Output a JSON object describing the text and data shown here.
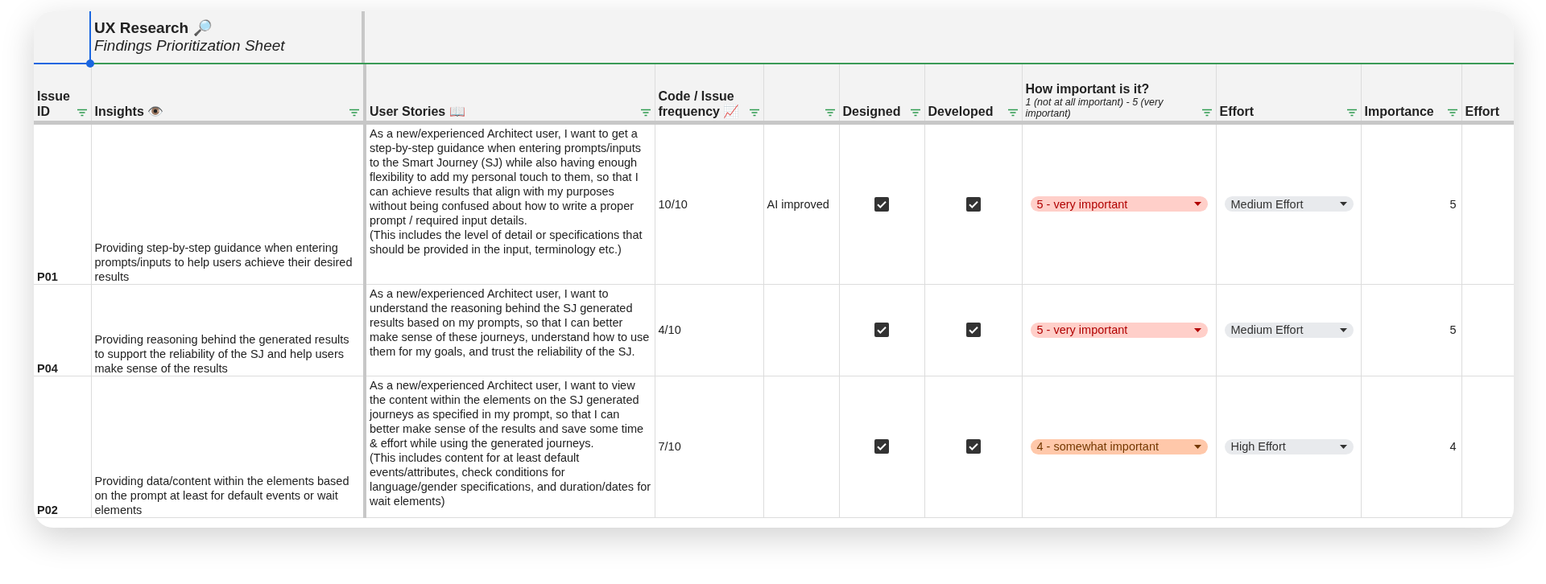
{
  "title": "UX Research 🔎",
  "subtitle": "Findings Prioritization Sheet",
  "columns": [
    {
      "label": "Issue ID",
      "filter": true
    },
    {
      "label": "Insights 👁️",
      "filter": true
    },
    {
      "label": "User Stories 📖",
      "filter": true
    },
    {
      "label": "Code / Issue frequency 📈",
      "filter": true
    },
    {
      "filter": true
    },
    {
      "label": "Designed",
      "filter": true
    },
    {
      "label": "Developed",
      "filter": true
    },
    {
      "label": "How important is it?",
      "note": "1 (not at all important) - 5 (very important)",
      "filter": true
    },
    {
      "label": "Effort",
      "filter": true
    },
    {
      "label": "Importance",
      "filter": true
    },
    {
      "label": "Effort",
      "filter": false
    }
  ],
  "rows": [
    {
      "issue_id": "P01",
      "insight": "Providing step-by-step guidance when entering prompts/inputs to help users achieve their desired results",
      "user_story": "As a new/experienced Architect user, I want to get a step-by-step guidance when entering prompts/inputs to the Smart Journey (SJ) while also having enough flexibility to add my personal touch to them, so that I can achieve results that align with my purposes without being confused about how to write a proper prompt / required input details.\n(This includes the level of detail or specifications that should be provided in the input, terminology etc.)",
      "frequency": "10/10",
      "column_5": "AI improved",
      "designed": true,
      "developed": true,
      "how_important": {
        "text": "5 - very important",
        "color": "#ffcfc9"
      },
      "effort": "Medium Effort",
      "importance": "5"
    },
    {
      "issue_id": "P04",
      "insight": "Providing reasoning behind the generated results to support the reliability of the SJ and help users make sense of the results",
      "user_story": "As a new/experienced Architect user, I want to understand the reasoning behind the SJ generated results based on my prompts, so that I can better make sense of these journeys, understand how to use them for my goals, and trust the reliability of the SJ.",
      "frequency": "4/10",
      "designed": true,
      "developed": true,
      "how_important": {
        "text": "5 - very important",
        "color": "#ffcfc9"
      },
      "effort": "Medium Effort",
      "importance": "5"
    },
    {
      "issue_id": "P02",
      "insight": "Providing data/content within the elements based on the prompt at least for default events or wait elements",
      "user_story": "As a new/experienced Architect user, I want to view the content within the elements on the SJ generated journeys as specified in my prompt, so that I can better make sense of the results and save some time & effort while using the generated journeys.\n(This includes content for at least default events/attributes, check conditions for language/gender specifications, and duration/dates for wait elements)",
      "frequency": "7/10",
      "designed": true,
      "developed": true,
      "how_important": {
        "text": "4 - somewhat important",
        "color": "#ffc8aa"
      },
      "effort": "High Effort",
      "importance": "4"
    }
  ]
}
